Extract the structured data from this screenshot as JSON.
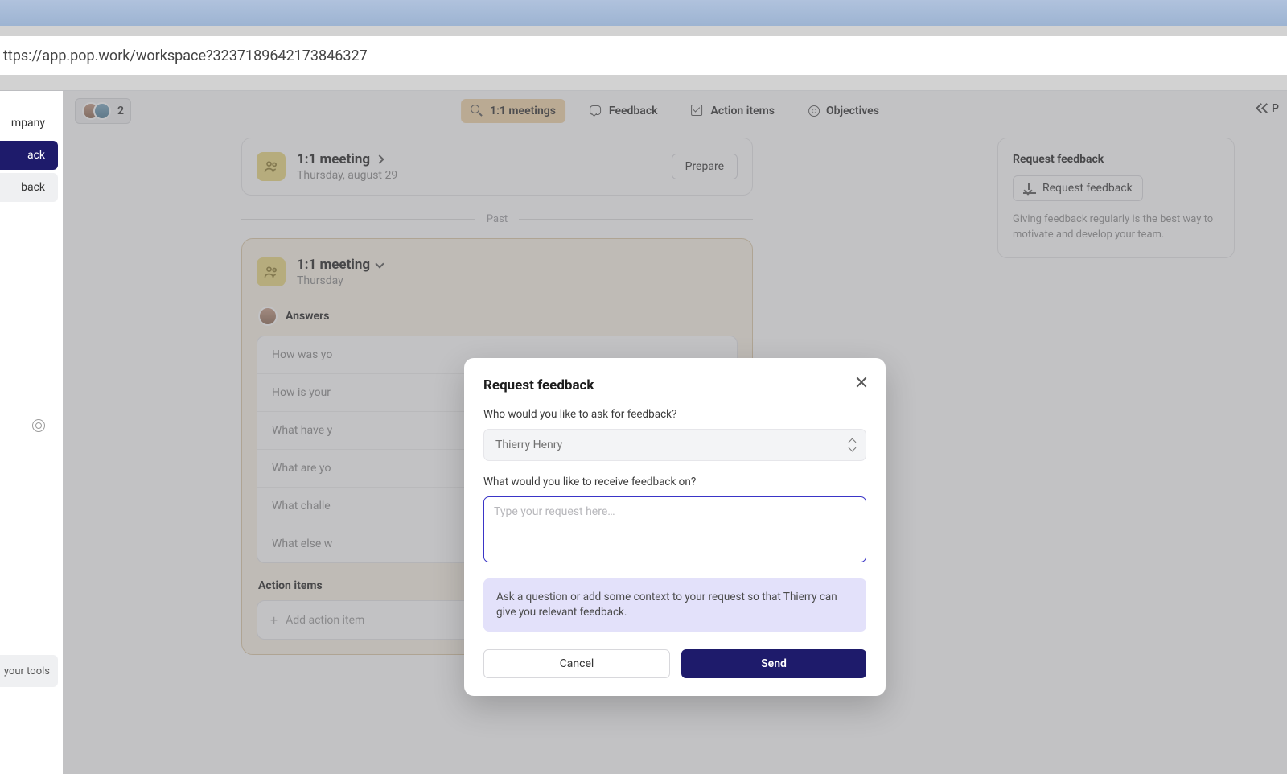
{
  "url": "ttps://app.pop.work/workspace?3237189642173846327",
  "sidebar": {
    "items": [
      {
        "label": "mpany"
      },
      {
        "label": "ack"
      },
      {
        "label": "back"
      }
    ],
    "tools_label": "your tools"
  },
  "header": {
    "avatar_count": "2",
    "tabs": {
      "meetings": "1:1 meetings",
      "feedback": "Feedback",
      "action_items": "Action items",
      "objectives": "Objectives"
    },
    "collapse_label": "P"
  },
  "feed": {
    "upcoming": {
      "title": "1:1 meeting",
      "date": "Thursday, august 29",
      "prepare": "Prepare"
    },
    "past_label": "Past",
    "past_meeting": {
      "title": "1:1 meeting",
      "date": "Thursday"
    },
    "answers_label": "Answers",
    "questions": [
      "How was yo",
      "How is your",
      "What have y",
      "What are yo",
      "What challe",
      "What else w"
    ],
    "action_items_label": "Action items",
    "add_action_label": "Add action item"
  },
  "right_panel": {
    "title": "Request feedback",
    "button": "Request feedback",
    "description": "Giving feedback regularly is the best way to motivate and develop your team."
  },
  "modal": {
    "title": "Request feedback",
    "who_label": "Who would you like to ask for feedback?",
    "selected_person": "Thierry Henry",
    "what_label": "What would you like to receive feedback on?",
    "placeholder": "Type your request here…",
    "hint": "Ask a question or add some context to your request so that Thierry can give you relevant feedback.",
    "cancel": "Cancel",
    "send": "Send"
  }
}
